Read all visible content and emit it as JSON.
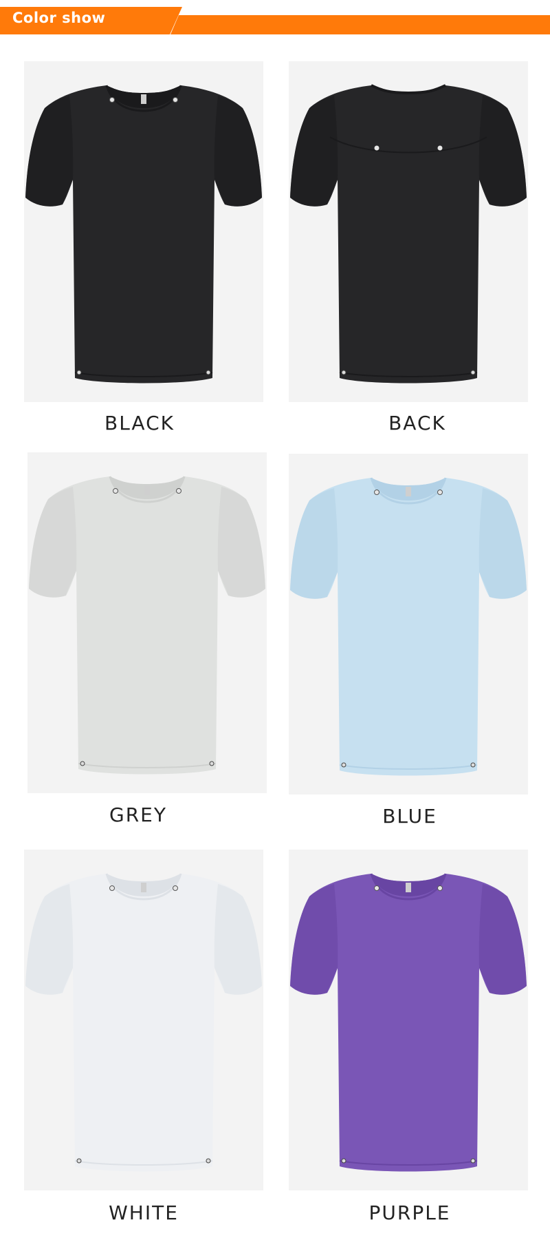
{
  "header": {
    "title": "Color show",
    "accent_color": "#ff7a0a"
  },
  "products": [
    {
      "label": "BLACK",
      "shirt_color": "#262628",
      "shade": "#1a1a1c",
      "view": "front"
    },
    {
      "label": "BACK",
      "shirt_color": "#262628",
      "shade": "#1a1a1c",
      "view": "back"
    },
    {
      "label": "GREY",
      "shirt_color": "#dfe1df",
      "shade": "#cfd1cf",
      "view": "front"
    },
    {
      "label": "BLUE",
      "shirt_color": "#c6e0f0",
      "shade": "#b2d1e6",
      "view": "front"
    },
    {
      "label": "WHITE",
      "shirt_color": "#eef0f3",
      "shade": "#dde1e6",
      "view": "front"
    },
    {
      "label": "PURPLE",
      "shirt_color": "#7a56b6",
      "shade": "#6845a3",
      "view": "front"
    }
  ]
}
